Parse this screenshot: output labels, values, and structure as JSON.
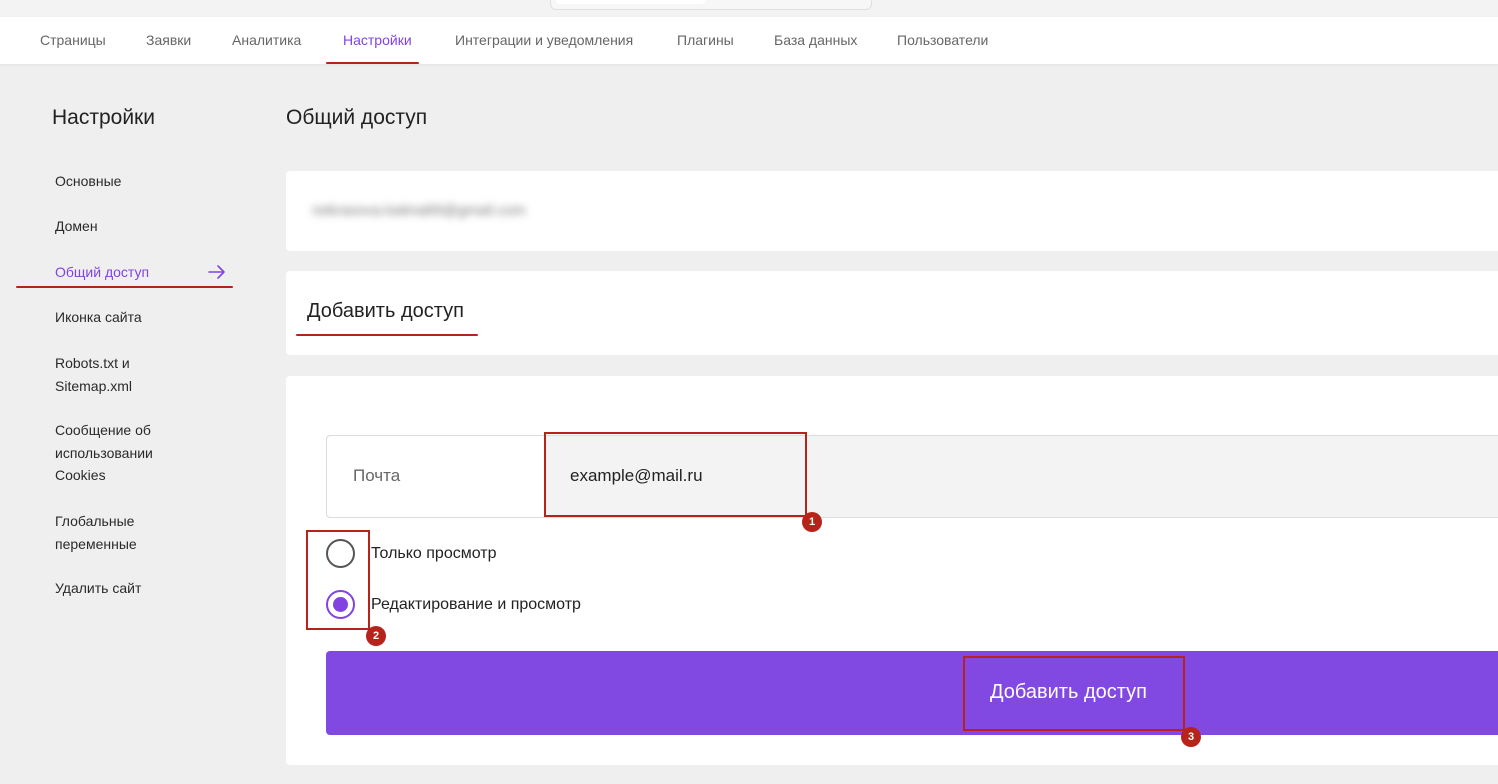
{
  "tabs": [
    "Страницы",
    "Заявки",
    "Аналитика",
    "Настройки",
    "Интеграции и уведомления",
    "Плагины",
    "База данных",
    "Пользователи"
  ],
  "active_tab": "Настройки",
  "sidebar": {
    "title": "Настройки",
    "items": [
      "Основные",
      "Домен",
      "Общий доступ",
      "Иконка сайта",
      "Robots.txt и\nSitemap.xml",
      "Сообщение об\nиспользовании\nCookies",
      "Глобальные\nпеременные",
      "Удалить сайт"
    ],
    "active_item": "Общий доступ",
    "active_item_icon": "arrow-right-icon"
  },
  "main": {
    "title": "Общий доступ",
    "existing_access_email": "nekrasova.katina89@gmail.com",
    "add_section_title": "Добавить доступ",
    "email_field": {
      "label": "Почта",
      "value": "example@mail.ru"
    },
    "radio_options": [
      {
        "label": "Только просмотр",
        "selected": false
      },
      {
        "label": "Редактирование и просмотр",
        "selected": true
      }
    ],
    "submit_label": "Добавить доступ"
  },
  "annotations": {
    "badges": [
      "1",
      "2",
      "3"
    ]
  },
  "colors": {
    "accent": "#8144e0",
    "button": "#8149e1",
    "annotation": "#b5231a",
    "background": "#efefef"
  }
}
